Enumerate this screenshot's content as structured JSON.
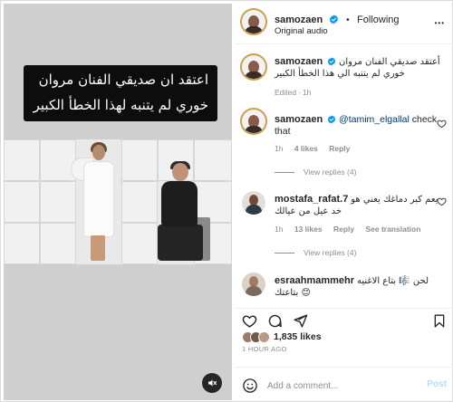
{
  "video": {
    "caption_line1": "اعتقد ان صديقي الفنان مروان",
    "caption_line2": "خوري لم يتنبه لهذا الخطأ الكبير"
  },
  "header": {
    "username": "samozaen",
    "separator": "•",
    "follow_status": "Following",
    "audio": "Original audio",
    "more": "•••"
  },
  "caption_comment": {
    "username": "samozaen",
    "text": "أعتقد صديقي الفنان مروان خوري لم يتنبه الي هذا الخطأ الكبير",
    "edited": "Edited",
    "time": "1h"
  },
  "comments": [
    {
      "username": "samozaen",
      "mention": "@tamim_elgallal",
      "text": "check that",
      "time": "1h",
      "likes": "4 likes",
      "reply": "Reply",
      "view_replies": "View replies (4)"
    },
    {
      "username": "mostafa_rafat.7",
      "text": "يعم كبر دماغك يعني هو خد عيل من عيالك",
      "time": "1h",
      "likes": "13 likes",
      "reply": "Reply",
      "translation": "See translation",
      "view_replies": "View replies (4)"
    },
    {
      "username": "esraahmammehr",
      "text": "لحن 🎼 بتاع الاغنيه بتاعتك 😊"
    }
  ],
  "actions": {
    "likes_count": "1,835 likes",
    "time_ago": "1 HOUR AGO"
  },
  "add_comment": {
    "placeholder": "Add a comment...",
    "post_label": "Post"
  },
  "colors": {
    "verified_blue": "#0095f6",
    "link_blue": "#00376b",
    "post_disabled": "#b2dffc"
  }
}
